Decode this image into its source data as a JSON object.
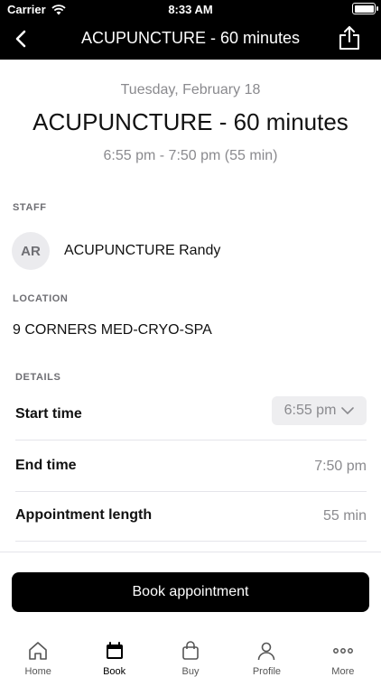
{
  "status_bar": {
    "carrier": "Carrier",
    "time": "8:33 AM"
  },
  "nav": {
    "title": "ACUPUNCTURE - 60 minutes",
    "back_icon": "chevron-left-icon",
    "share_icon": "share-icon"
  },
  "appointment": {
    "date": "Tuesday, February 18",
    "service": "ACUPUNCTURE - 60 minutes",
    "time_range": "6:55 pm - 7:50 pm (55 min)"
  },
  "staff": {
    "section_label": "STAFF",
    "initials": "AR",
    "name": "ACUPUNCTURE Randy"
  },
  "location": {
    "section_label": "LOCATION",
    "name": "9 CORNERS MED-CRYO-SPA"
  },
  "details": {
    "section_label": "DETAILS",
    "start_time_label": "Start time",
    "start_time_value": "6:55 pm",
    "end_time_label": "End time",
    "end_time_value": "7:50 pm",
    "length_label": "Appointment length",
    "length_value": "55 min"
  },
  "book_button": "Book appointment",
  "tabs": [
    {
      "label": "Home",
      "icon": "home-icon",
      "active": false
    },
    {
      "label": "Book",
      "icon": "calendar-icon",
      "active": true
    },
    {
      "label": "Buy",
      "icon": "shopping-bag-icon",
      "active": false
    },
    {
      "label": "Profile",
      "icon": "profile-icon",
      "active": false
    },
    {
      "label": "More",
      "icon": "more-icon",
      "active": false
    }
  ]
}
